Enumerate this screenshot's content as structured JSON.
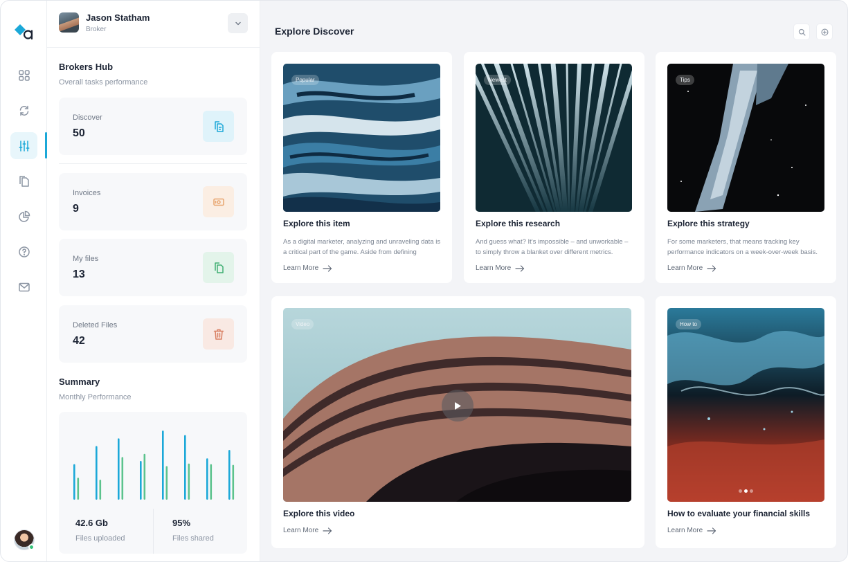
{
  "user": {
    "name": "Jason Statham",
    "role": "Broker"
  },
  "hub": {
    "title": "Brokers Hub",
    "subtitle": "Overall tasks performance",
    "stats": [
      {
        "label": "Discover",
        "value": "50",
        "icon": "copy-icon",
        "color": "#1ba8d8"
      },
      {
        "label": "Invoices",
        "value": "9",
        "icon": "money-icon",
        "color": "#e8a56f"
      },
      {
        "label": "My files",
        "value": "13",
        "icon": "files-icon",
        "color": "#3fae72"
      },
      {
        "label": "Deleted Files",
        "value": "42",
        "icon": "trash-icon",
        "color": "#d98063"
      }
    ]
  },
  "summary": {
    "title": "Summary",
    "subtitle": "Monthly Performance",
    "uploaded_value": "42.6 Gb",
    "uploaded_label": "Files uploaded",
    "shared_value": "95%",
    "shared_label": "Files shared"
  },
  "chart_data": {
    "type": "bar",
    "series": [
      {
        "values": [
          55,
          83,
          95,
          60,
          107,
          100,
          64,
          77
        ]
      },
      {
        "values": [
          34,
          31,
          66,
          71,
          52,
          56,
          55,
          54
        ]
      }
    ],
    "ylim": [
      0,
      120
    ],
    "colors": [
      "#1ba8d8",
      "#5cc38d"
    ],
    "grid": false
  },
  "main": {
    "title": "Explore Discover",
    "cards": [
      {
        "tag": "Popular",
        "title": "Explore this item",
        "text": "As a digital marketer, analyzing and unraveling data is a critical part of the game. Aside from defining",
        "link": "Learn More"
      },
      {
        "tag": "Newest",
        "title": "Explore this research",
        "text": "And guess what? It's impossible – and unworkable – to simply throw a blanket over different metrics.",
        "link": "Learn More"
      },
      {
        "tag": "Tips",
        "title": "Explore this strategy",
        "text": "For some marketers, that means tracking key performance indicators on a week-over-week basis.",
        "link": "Learn More"
      },
      {
        "tag": "Video",
        "title": "Explore this video",
        "link": "Learn More"
      },
      {
        "tag": "How to",
        "title": "How to evaluate your financial skills",
        "link": "Learn More"
      }
    ]
  },
  "colors": {
    "accent": "#1ba8d8",
    "background": "#f3f4f7"
  }
}
